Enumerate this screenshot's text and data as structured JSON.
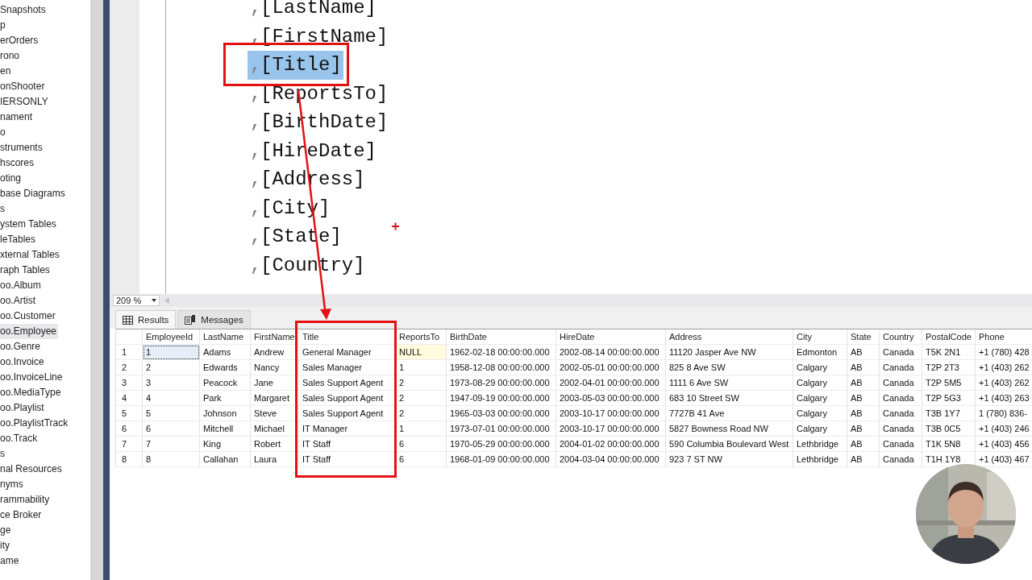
{
  "object_explorer": {
    "items": [
      {
        "label": "Snapshots",
        "selected": false
      },
      {
        "label": "p",
        "selected": false
      },
      {
        "label": "erOrders",
        "selected": false
      },
      {
        "label": "rono",
        "selected": false
      },
      {
        "label": "en",
        "selected": false
      },
      {
        "label": "onShooter",
        "selected": false
      },
      {
        "label": "IERSONLY",
        "selected": false
      },
      {
        "label": "nament",
        "selected": false
      },
      {
        "label": "o",
        "selected": false
      },
      {
        "label": "struments",
        "selected": false
      },
      {
        "label": "hscores",
        "selected": false
      },
      {
        "label": "oting",
        "selected": false
      },
      {
        "label": "base Diagrams",
        "selected": false
      },
      {
        "label": "s",
        "selected": false
      },
      {
        "label": "ystem Tables",
        "selected": false
      },
      {
        "label": "leTables",
        "selected": false
      },
      {
        "label": "xternal Tables",
        "selected": false
      },
      {
        "label": "raph Tables",
        "selected": false
      },
      {
        "label": "oo.Album",
        "selected": false
      },
      {
        "label": "oo.Artist",
        "selected": false
      },
      {
        "label": "oo.Customer",
        "selected": false
      },
      {
        "label": "oo.Employee",
        "selected": true
      },
      {
        "label": "oo.Genre",
        "selected": false
      },
      {
        "label": "oo.Invoice",
        "selected": false
      },
      {
        "label": "oo.InvoiceLine",
        "selected": false
      },
      {
        "label": "oo.MediaType",
        "selected": false
      },
      {
        "label": "oo.Playlist",
        "selected": false
      },
      {
        "label": "oo.PlaylistTrack",
        "selected": false
      },
      {
        "label": "oo.Track",
        "selected": false
      },
      {
        "label": "s",
        "selected": false
      },
      {
        "label": "nal Resources",
        "selected": false
      },
      {
        "label": "nyms",
        "selected": false
      },
      {
        "label": "rammability",
        "selected": false
      },
      {
        "label": "ce Broker",
        "selected": false
      },
      {
        "label": "ge",
        "selected": false
      },
      {
        "label": "ity",
        "selected": false
      },
      {
        "label": "ame",
        "selected": false
      }
    ]
  },
  "editor": {
    "lines": [
      {
        "prefix": ",",
        "text": "[LastName]",
        "selected": false
      },
      {
        "prefix": ",",
        "text": "[FirstName]",
        "selected": false
      },
      {
        "prefix": ",",
        "text": "[Title]",
        "selected": true
      },
      {
        "prefix": ",",
        "text": "[ReportsTo]",
        "selected": false
      },
      {
        "prefix": ",",
        "text": "[BirthDate]",
        "selected": false
      },
      {
        "prefix": ",",
        "text": "[HireDate]",
        "selected": false
      },
      {
        "prefix": ",",
        "text": "[Address]",
        "selected": false
      },
      {
        "prefix": ",",
        "text": "[City]",
        "selected": false
      },
      {
        "prefix": ",",
        "text": "[State]",
        "selected": false
      },
      {
        "prefix": ",",
        "text": "[Country]",
        "selected": false
      }
    ],
    "zoom": "209 %"
  },
  "results": {
    "tabs": [
      {
        "label": "Results",
        "selected": true
      },
      {
        "label": "Messages",
        "selected": false
      }
    ],
    "columns": [
      "EmployeeId",
      "LastName",
      "FirstName",
      "Title",
      "ReportsTo",
      "BirthDate",
      "HireDate",
      "Address",
      "City",
      "State",
      "Country",
      "PostalCode",
      "Phone"
    ],
    "rows": [
      {
        "number": "1",
        "selected": true,
        "cells": [
          "1",
          "Adams",
          "Andrew",
          "General Manager",
          {
            "text": "NULL",
            "kind": "null"
          },
          "1962-02-18 00:00:00.000",
          "2002-08-14 00:00:00.000",
          "11120 Jasper Ave NW",
          "Edmonton",
          "AB",
          "Canada",
          "T5K 2N1",
          "+1 (780) 428"
        ]
      },
      {
        "number": "2",
        "selected": false,
        "cells": [
          "2",
          "Edwards",
          "Nancy",
          "Sales Manager",
          "1",
          "1958-12-08 00:00:00.000",
          "2002-05-01 00:00:00.000",
          "825 8 Ave SW",
          "Calgary",
          "AB",
          "Canada",
          "T2P 2T3",
          "+1 (403) 262"
        ]
      },
      {
        "number": "3",
        "selected": false,
        "cells": [
          "3",
          "Peacock",
          "Jane",
          "Sales Support Agent",
          "2",
          "1973-08-29 00:00:00.000",
          "2002-04-01 00:00:00.000",
          "1111 6 Ave SW",
          "Calgary",
          "AB",
          "Canada",
          "T2P 5M5",
          "+1 (403) 262"
        ]
      },
      {
        "number": "4",
        "selected": false,
        "cells": [
          "4",
          "Park",
          "Margaret",
          "Sales Support Agent",
          "2",
          "1947-09-19 00:00:00.000",
          "2003-05-03 00:00:00.000",
          "683 10 Street SW",
          "Calgary",
          "AB",
          "Canada",
          "T2P 5G3",
          "+1 (403) 263"
        ]
      },
      {
        "number": "5",
        "selected": false,
        "cells": [
          "5",
          "Johnson",
          "Steve",
          "Sales Support Agent",
          "2",
          "1965-03-03 00:00:00.000",
          "2003-10-17 00:00:00.000",
          "7727B 41 Ave",
          "Calgary",
          "AB",
          "Canada",
          "T3B 1Y7",
          "1 (780) 836-"
        ]
      },
      {
        "number": "6",
        "selected": false,
        "cells": [
          "6",
          "Mitchell",
          "Michael",
          "IT Manager",
          "1",
          "1973-07-01 00:00:00.000",
          "2003-10-17 00:00:00.000",
          "5827 Bowness Road NW",
          "Calgary",
          "AB",
          "Canada",
          "T3B 0C5",
          "+1 (403) 246"
        ]
      },
      {
        "number": "7",
        "selected": false,
        "cells": [
          "7",
          "King",
          "Robert",
          "IT Staff",
          "6",
          "1970-05-29 00:00:00.000",
          "2004-01-02 00:00:00.000",
          "590 Columbia Boulevard West",
          "Lethbridge",
          "AB",
          "Canada",
          "T1K 5N8",
          "+1 (403) 456"
        ]
      },
      {
        "number": "8",
        "selected": false,
        "cells": [
          "8",
          "Callahan",
          "Laura",
          "IT Staff",
          "6",
          "1968-01-09 00:00:00.000",
          "2004-03-04 00:00:00.000",
          "923 7 ST NW",
          "Lethbridge",
          "AB",
          "Canada",
          "T1H 1Y8",
          "+1 (403) 467"
        ]
      }
    ]
  }
}
